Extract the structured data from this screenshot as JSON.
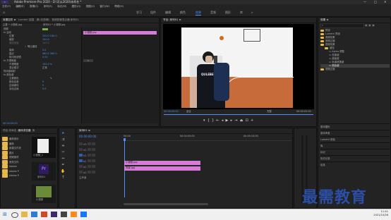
{
  "app": {
    "title": "Adobe Premiere Pro 2020 - D:\\可以2020\\未命名 *",
    "window_controls": [
      "—",
      "□",
      "✕"
    ]
  },
  "menu": [
    "文件(F)",
    "编辑(E)",
    "剪辑(C)",
    "序列(S)",
    "标记(M)",
    "图形(G)",
    "视图(V)",
    "窗口(W)",
    "帮助(H)"
  ],
  "workspaces": [
    "学习",
    "组件",
    "编辑",
    "颜色",
    "效果",
    "音频",
    "图形",
    "库",
    "»"
  ],
  "workspace_active": "效果",
  "effect_controls": {
    "tabs": [
      "效果控件 ≡",
      "Lumetri 范围",
      "源:(无剪辑)",
      "音频剪辑混合器:序列01"
    ],
    "header_left": "主要 * 小视频.jpg",
    "header_right": "序列01 * 小视频.jpg",
    "clip_label": "小视频.jpg",
    "rows": [
      {
        "label": "视频",
        "value": ""
      },
      {
        "label": "fx 运动",
        "value": ""
      },
      {
        "label": "位置",
        "value": "320.0  180.0"
      },
      {
        "label": "缩放",
        "value": "100.0"
      },
      {
        "label": "缩放宽度",
        "value": "100.0"
      },
      {
        "label": "等比缩放",
        "value": "✓"
      },
      {
        "label": "旋转",
        "value": "0.0"
      },
      {
        "label": "锚点",
        "value": "480.0  360.0"
      },
      {
        "label": "防闪烁滤镜",
        "value": "0.00"
      },
      {
        "label": "fx 不透明度",
        "value": ""
      },
      {
        "label": "不透明度",
        "value": "100.0 %"
      },
      {
        "label": "混合模式",
        "value": "正常"
      },
      {
        "label": "时间重映射",
        "value": ""
      },
      {
        "label": "fx 颜色键",
        "value": ""
      },
      {
        "label": "主要颜色",
        "value": ""
      },
      {
        "label": "颜色容差",
        "value": "0"
      },
      {
        "label": "边缘细化",
        "value": "0"
      },
      {
        "label": "羽化边缘",
        "value": "0.0"
      }
    ],
    "timecode": "00:00:00:00"
  },
  "program": {
    "tab": "节目: 序列01 ≡",
    "timecode_left": "00:00:00:00",
    "fit": "适合",
    "quality": "完整",
    "timecode_right": "00:00:05:00",
    "overlay_text": "QULEBEI"
  },
  "effects": {
    "tab": "效果 ≡",
    "search_placeholder": "",
    "tree": [
      {
        "label": "预设",
        "indent": 0
      },
      {
        "label": "Lumetri 预设",
        "indent": 0
      },
      {
        "label": "音频效果",
        "indent": 0
      },
      {
        "label": "音频过渡",
        "indent": 0
      },
      {
        "label": "视频效果",
        "indent": 0
      },
      {
        "label": "键控",
        "indent": 1
      },
      {
        "label": "Alpha 调整",
        "indent": 2
      },
      {
        "label": "亮度键",
        "indent": 2
      },
      {
        "label": "超级键",
        "indent": 2
      },
      {
        "label": "轨道遮罩键",
        "indent": 2
      },
      {
        "label": "颜色键",
        "indent": 2
      },
      {
        "label": "视频过渡",
        "indent": 0
      }
    ],
    "selected_index": 10,
    "extra_panels": [
      "基本图形",
      "基本声音",
      "Lumetri 颜色",
      "库",
      "标记",
      "历史记录",
      "信息"
    ]
  },
  "project": {
    "tabs": [
      "项目:未命名",
      "媒体浏览器",
      "库"
    ],
    "items": [
      "最新音乐",
      "最新",
      "新建文件夹",
      "图片",
      "视频素材",
      "音效文件",
      "Adobe",
      "Adobe P",
      "Adobe P"
    ],
    "thumb_labels": [
      "小视频_1",
      "序列01",
      "小视频"
    ]
  },
  "timeline": {
    "tab": "序列01 ≡",
    "timecode": "00:00:00:00",
    "ruler": [
      "00:00",
      "00:00:05:00",
      "00:00:10:00"
    ],
    "tracks": [
      "V3",
      "V2",
      "V1",
      "A1",
      "A2",
      "A3",
      "主声道"
    ],
    "clips": [
      {
        "label": "小视频.jpg",
        "track": "V2"
      },
      {
        "label": "背景.jpg",
        "track": "V1"
      }
    ]
  },
  "taskbar": {
    "time": "11:41",
    "date": "2021/10/26"
  },
  "watermark": "最需教育",
  "colors": {
    "accent": "#4d90ff",
    "clip": "#d67bd8",
    "folder": "#e6b84a"
  }
}
